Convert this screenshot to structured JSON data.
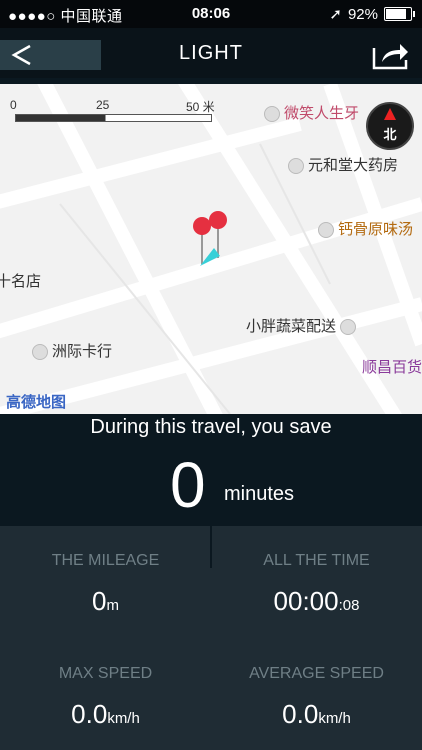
{
  "status_bar": {
    "carrier": "●●●●○ 中国联通",
    "time": "08:06",
    "battery": "92%"
  },
  "navbar": {
    "title": "LIGHT"
  },
  "map": {
    "scale_labels": [
      "0",
      "25",
      "50 米"
    ],
    "compass_label": "北",
    "pois": [
      "微笑人生牙",
      "元和堂大药房",
      "钙骨原味汤",
      "小胖蔬菜配送",
      "洲际卡行",
      "顺昌百货",
      "十名店"
    ],
    "watermark": "高德地图"
  },
  "summary": {
    "message": "During this travel, you save",
    "value": "0",
    "unit": "minutes"
  },
  "stats": {
    "mileage": {
      "label": "THE MILEAGE",
      "value": "0",
      "unit": "m"
    },
    "all_time": {
      "label": "ALL THE TIME",
      "value": "00:00",
      "sub": ":08"
    },
    "max_speed": {
      "label": "MAX SPEED",
      "value": "0.0",
      "unit": "km/h"
    },
    "avg_speed": {
      "label": "AVERAGE SPEED",
      "value": "0.0",
      "unit": "km/h"
    }
  }
}
